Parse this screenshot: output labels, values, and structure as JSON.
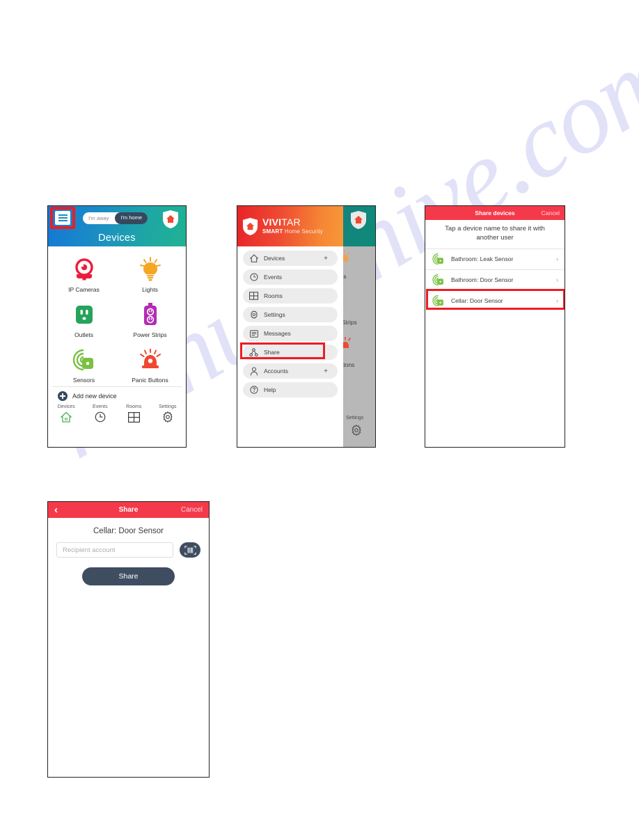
{
  "watermark": {
    "text": "manualshive.com"
  },
  "screen1": {
    "name": "devices-screen",
    "header": {
      "menu_icon": "hamburger-icon",
      "toggle_away_label": "I'm away",
      "toggle_home_label": "I'm home",
      "shield_icon": "home-shield-icon",
      "title": "Devices"
    },
    "tiles": [
      {
        "label": "IP Cameras",
        "icon": "ip-camera-icon",
        "color": "#ed1c3c"
      },
      {
        "label": "Lights",
        "icon": "light-bulb-icon",
        "color": "#f5a623"
      },
      {
        "label": "Outlets",
        "icon": "outlet-icon",
        "color": "#27a25b"
      },
      {
        "label": "Power Strips",
        "icon": "power-strip-icon",
        "color": "#b32bb3"
      },
      {
        "label": "Sensors",
        "icon": "sensor-icon",
        "color": "#7ac143"
      },
      {
        "label": "Panic Buttons",
        "icon": "panic-button-icon",
        "color": "#f0492f"
      }
    ],
    "add_new_device_label": "Add new device",
    "tabs": [
      {
        "label": "Devices",
        "icon": "home-icon",
        "active": true
      },
      {
        "label": "Events",
        "icon": "clock-icon",
        "active": false
      },
      {
        "label": "Rooms",
        "icon": "grid-icon",
        "active": false
      },
      {
        "label": "Settings",
        "icon": "gear-icon",
        "active": false
      }
    ]
  },
  "screen2": {
    "name": "menu-drawer-screen",
    "brand": {
      "line1_bold": "VIVI",
      "line1_thin": "TAR",
      "line2_bold": "SMART",
      "line2_rest": " Home Security"
    },
    "menu_items": [
      {
        "label": "Devices",
        "icon": "home-icon",
        "plus": "+"
      },
      {
        "label": "Events",
        "icon": "clock-icon",
        "plus": ""
      },
      {
        "label": "Rooms",
        "icon": "grid-icon",
        "plus": ""
      },
      {
        "label": "Settings",
        "icon": "gear-icon",
        "plus": ""
      },
      {
        "label": "Messages",
        "icon": "message-icon",
        "plus": ""
      },
      {
        "label": "Share",
        "icon": "share-icon",
        "plus": ""
      },
      {
        "label": "Accounts",
        "icon": "person-icon",
        "plus": "+"
      },
      {
        "label": "Help",
        "icon": "question-icon",
        "plus": ""
      }
    ],
    "highlight_item": "Share",
    "background_fragments": [
      {
        "text": "ts"
      },
      {
        "text": "Strips"
      },
      {
        "text": "ttons"
      },
      {
        "text": "Settings"
      }
    ]
  },
  "screen3": {
    "name": "share-devices-screen",
    "header": {
      "title": "Share devices",
      "cancel_label": "Cancel"
    },
    "hint": "Tap a device name to share it with another user",
    "devices": [
      {
        "label": "Bathroom: Leak Sensor",
        "icon": "sensor-icon",
        "chevron": "›"
      },
      {
        "label": "Bathroom: Door Sensor",
        "icon": "sensor-icon",
        "chevron": "›"
      },
      {
        "label": "Cellar: Door Sensor",
        "icon": "sensor-icon",
        "chevron": "›"
      }
    ],
    "highlight_device": "Cellar: Door Sensor"
  },
  "screen4": {
    "name": "share-form-screen",
    "header": {
      "back_icon": "chevron-left-icon",
      "title": "Share",
      "cancel_label": "Cancel"
    },
    "device_name": "Cellar: Door Sensor",
    "recipient_placeholder": "Recipient account",
    "recipient_value": "",
    "scan_icon": "barcode-scan-icon",
    "share_button_label": "Share"
  },
  "colors": {
    "red_header": "#f43a4a",
    "highlight_red": "#ee1c25",
    "dark_slate": "#3f4d61",
    "brand_red": "#e8232a",
    "brand_orange": "#f79838",
    "header_blue": "#1478d4",
    "header_teal": "#20b293"
  }
}
